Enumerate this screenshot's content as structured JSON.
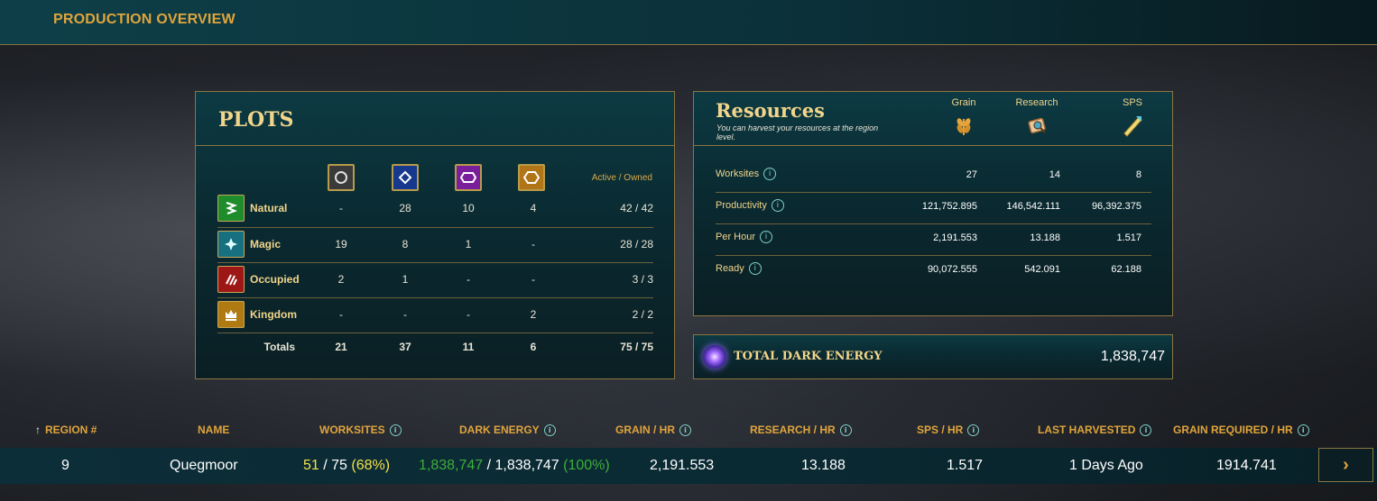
{
  "header": {
    "title": "PRODUCTION OVERVIEW"
  },
  "plots": {
    "title": "PLOTS",
    "active_owned_label": "Active / Owned",
    "column_icons": [
      "rarity-common-icon",
      "rarity-rare-icon",
      "rarity-epic-icon",
      "rarity-legendary-icon"
    ],
    "rows": [
      {
        "label": "Natural",
        "icon": "natural-icon",
        "color": "#2fa53a",
        "values": [
          "-",
          "28",
          "10",
          "4"
        ],
        "total": "42 / 42"
      },
      {
        "label": "Magic",
        "icon": "magic-icon",
        "color": "#1e8aa0",
        "values": [
          "19",
          "8",
          "1",
          "-"
        ],
        "total": "28 / 28"
      },
      {
        "label": "Occupied",
        "icon": "occupied-icon",
        "color": "#b31e1e",
        "values": [
          "2",
          "1",
          "-",
          "-"
        ],
        "total": "3 / 3"
      },
      {
        "label": "Kingdom",
        "icon": "kingdom-icon",
        "color": "#c08a17",
        "values": [
          "-",
          "-",
          "-",
          "2"
        ],
        "total": "2 / 2"
      }
    ],
    "totals": {
      "label": "Totals",
      "values": [
        "21",
        "37",
        "11",
        "6"
      ],
      "total": "75 / 75"
    }
  },
  "resources": {
    "title": "Resources",
    "subtitle": "You can harvest your resources at the region level.",
    "columns": [
      "Grain",
      "Research",
      "SPS"
    ],
    "rows": [
      {
        "label": "Worksites",
        "values": [
          "27",
          "14",
          "8"
        ]
      },
      {
        "label": "Productivity",
        "values": [
          "121,752.895",
          "146,542.111",
          "96,392.375"
        ]
      },
      {
        "label": "Per Hour",
        "values": [
          "2,191.553",
          "13.188",
          "1.517"
        ]
      },
      {
        "label": "Ready",
        "values": [
          "90,072.555",
          "542.091",
          "62.188"
        ]
      }
    ]
  },
  "dark_energy": {
    "label": "TOTAL DARK ENERGY",
    "value": "1,838,747"
  },
  "table": {
    "headers": {
      "region": "REGION #",
      "name": "NAME",
      "worksites": "WORKSITES",
      "dark_energy": "DARK ENERGY",
      "grain": "GRAIN / HR",
      "research": "RESEARCH / HR",
      "sps": "SPS / HR",
      "last_harvested": "LAST HARVESTED",
      "grain_required": "GRAIN REQUIRED / HR"
    },
    "row": {
      "region": "9",
      "name": "Quegmoor",
      "worksites_active": "51",
      "worksites_total": " / 75 ",
      "worksites_pct": "(68%)",
      "de_active": "1,838,747",
      "de_total": " / 1,838,747 ",
      "de_pct": "(100%)",
      "grain": "2,191.553",
      "research": "13.188",
      "sps": "1.517",
      "last_harvested": "1 Days Ago",
      "grain_required": "1914.741"
    }
  },
  "colors": {
    "accent": "#e0a53c",
    "gold_text": "#f1d58b",
    "border": "#8d7640",
    "green": "#3fae3a",
    "yellow": "#f4e04b"
  }
}
